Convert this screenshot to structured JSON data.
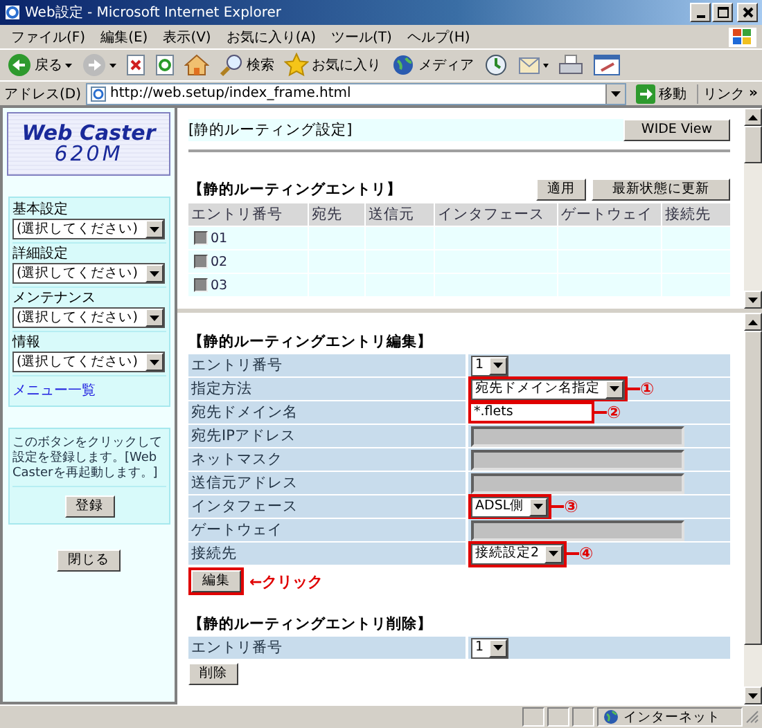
{
  "window": {
    "title": "Web設定 - Microsoft Internet Explorer"
  },
  "menu": [
    "ファイル(F)",
    "編集(E)",
    "表示(V)",
    "お気に入り(A)",
    "ツール(T)",
    "ヘルプ(H)"
  ],
  "toolbar": [
    {
      "kind": "back",
      "label": "戻る"
    },
    {
      "kind": "forward"
    },
    {
      "kind": "stop"
    },
    {
      "kind": "refresh"
    },
    {
      "kind": "home"
    },
    {
      "kind": "search",
      "label": "検索"
    },
    {
      "kind": "favorites",
      "label": "お気に入り"
    },
    {
      "kind": "media",
      "label": "メディア"
    },
    {
      "kind": "history"
    },
    {
      "kind": "mail"
    },
    {
      "kind": "print"
    },
    {
      "kind": "edit"
    }
  ],
  "address": {
    "label": "アドレス(D)",
    "url": "http://web.setup/index_frame.html",
    "go": "移動",
    "links": "リンク",
    "more": "»"
  },
  "sidebar": {
    "logo": [
      "Web Caster",
      "620M"
    ],
    "menus": [
      {
        "label": "基本設定",
        "value": "(選択してください)"
      },
      {
        "label": "詳細設定",
        "value": "(選択してください)"
      },
      {
        "label": "メンテナンス",
        "value": "(選択してください)"
      },
      {
        "label": "情報",
        "value": "(選択してください)"
      }
    ],
    "menu_link": "メニュー一覧",
    "note": "このボタンをクリックして設定を登録します。[Web Casterを再起動します。]",
    "register": "登録",
    "close": "閉じる"
  },
  "top": {
    "title": "[静的ルーティング設定]",
    "wide_button": "WIDE View",
    "section": "【静的ルーティングエントリ】",
    "apply": "適用",
    "refresh": "最新状態に更新",
    "columns": [
      "エントリ番号",
      "宛先",
      "送信元",
      "インタフェース",
      "ゲートウェイ",
      "接続先"
    ],
    "rows": [
      {
        "checked": false,
        "number": "01"
      },
      {
        "checked": false,
        "number": "02"
      },
      {
        "checked": false,
        "number": "03"
      }
    ]
  },
  "edit": {
    "title": "【静的ルーティングエントリ編集】",
    "fields": [
      {
        "label": "エントリ番号",
        "kind": "select",
        "value": "1"
      },
      {
        "label": "指定方法",
        "kind": "select",
        "value": "宛先ドメイン名指定",
        "callout": "①"
      },
      {
        "label": "宛先ドメイン名",
        "kind": "text",
        "value": "*.flets",
        "callout": "②"
      },
      {
        "label": "宛先IPアドレス",
        "kind": "disabled"
      },
      {
        "label": "ネットマスク",
        "kind": "disabled"
      },
      {
        "label": "送信元アドレス",
        "kind": "disabled"
      },
      {
        "label": "インタフェース",
        "kind": "select",
        "value": "ADSL側",
        "callout": "③"
      },
      {
        "label": "ゲートウェイ",
        "kind": "disabled"
      },
      {
        "label": "接続先",
        "kind": "select",
        "value": "接続設定2",
        "callout": "④"
      }
    ],
    "button": "編集",
    "annotation": "←クリック"
  },
  "delete": {
    "title": "【静的ルーティングエントリ削除】",
    "fields": [
      {
        "label": "エントリ番号",
        "kind": "select",
        "value": "1"
      }
    ],
    "button": "削除"
  },
  "status_bar": {
    "zone": "インターネット"
  }
}
